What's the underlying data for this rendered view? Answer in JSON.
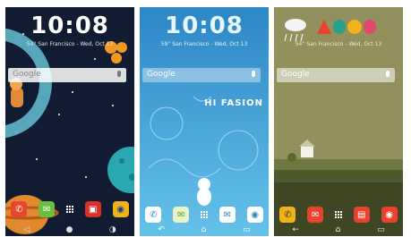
{
  "screens": [
    {
      "time": "10:08",
      "subtitle": "54° San Francisco - Wed, Oct 13",
      "search_label": "Google",
      "nav": [
        "◁",
        "●",
        "◑"
      ]
    },
    {
      "time": "10:08",
      "subtitle": "59° San Francisco - Wed, Oct 13",
      "search_label": "Google",
      "brand": "HI FASION",
      "nav": [
        "↶",
        "⌂",
        "▭"
      ]
    },
    {
      "time": "10:08",
      "subtitle": "54° San Francisco - Wed, Oct 13",
      "search_label": "Google",
      "nav": [
        "←",
        "⌂",
        "▭"
      ]
    }
  ]
}
